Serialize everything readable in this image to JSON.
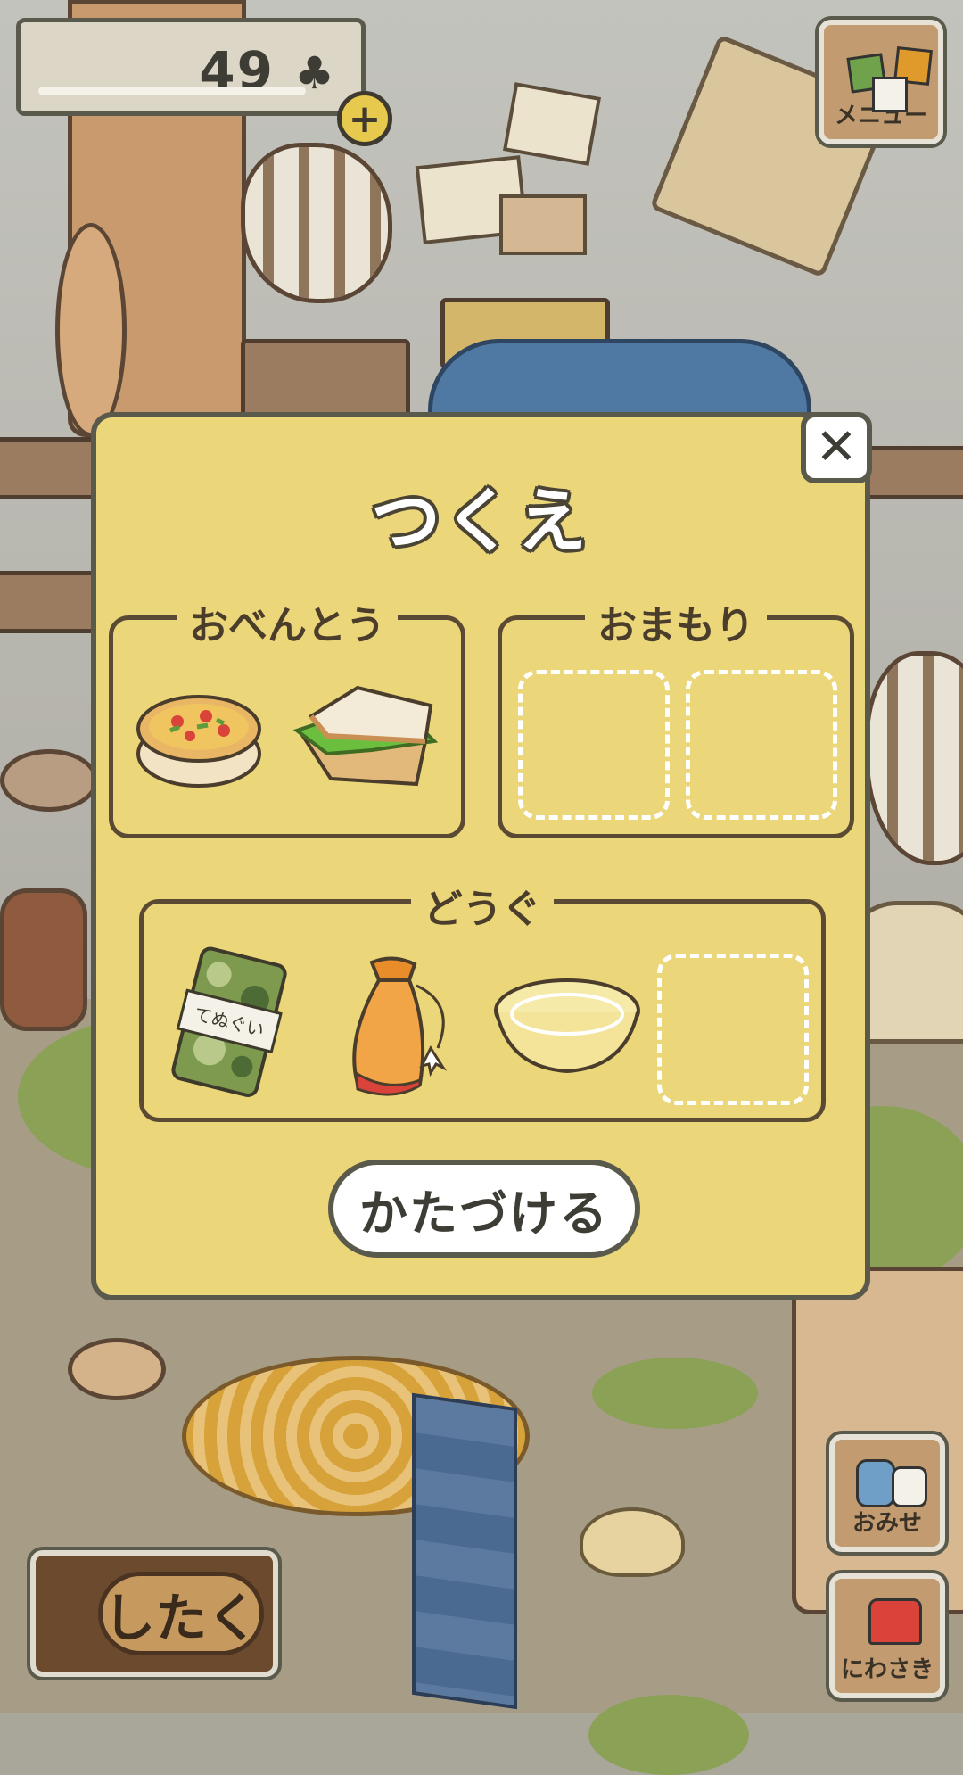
{
  "hud": {
    "clover_count": "49",
    "clover_icon": "clover-icon",
    "add_icon": "plus-icon"
  },
  "side_menu": {
    "menu_label": "メニュー",
    "shop_label": "おみせ",
    "yard_label": "にわさき"
  },
  "prepare_button": {
    "label": "したく"
  },
  "dialog": {
    "title": "つくえ",
    "sections": {
      "lunch": {
        "label": "おべんとう",
        "items": [
          {
            "icon": "quiche-icon"
          },
          {
            "icon": "sandwich-icon"
          }
        ]
      },
      "charm": {
        "label": "おまもり",
        "empty_slots": 2
      },
      "tools": {
        "label": "どうぐ",
        "items": [
          {
            "icon": "camo-tenugui-icon",
            "tag_text": "てぬぐい"
          },
          {
            "icon": "orange-bag-icon"
          },
          {
            "icon": "glass-bowl-icon"
          }
        ],
        "empty_slots": 1
      }
    },
    "put_away_label": "かたづける",
    "close_icon": "close-icon"
  },
  "colors": {
    "dialog_bg": "#ecd67a",
    "border": "#5a5a4c",
    "slot_dash": "#ffffff",
    "clover_plus": "#e7c94d"
  }
}
